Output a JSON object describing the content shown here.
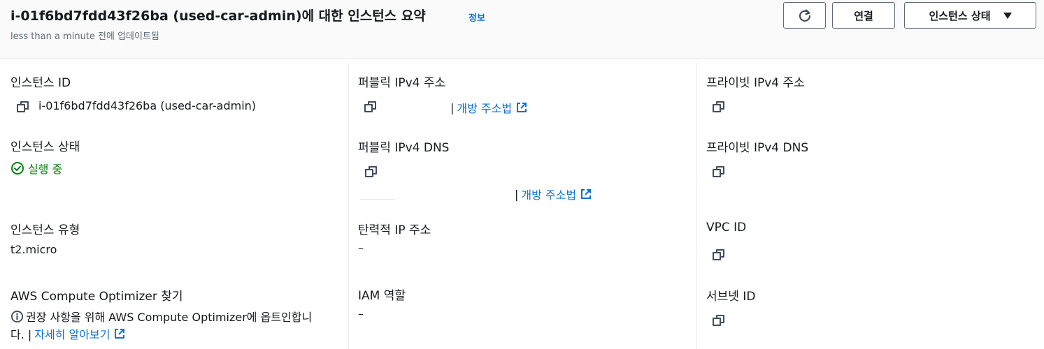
{
  "header": {
    "title": "i-01f6bd7fdd43f26ba (used-car-admin)에 대한 인스턴스 요약",
    "info_link": "정보",
    "updated": "less than a minute 전에 업데이트됨",
    "connect_label": "연결",
    "state_label": "인스턴스 상태"
  },
  "col1": {
    "instance_id_label": "인스턴스 ID",
    "instance_id_value": "i-01f6bd7fdd43f26ba (used-car-admin)",
    "state_label": "인스턴스 상태",
    "state_value": "실행 중",
    "type_label": "인스턴스 유형",
    "type_value": "t2.micro",
    "optimizer_label": "AWS Compute Optimizer 찾기",
    "optimizer_text_line1": "권장 사항을 위해 AWS Compute Optimizer에 옵트인합니",
    "optimizer_text_line2": "다. |",
    "optimizer_link": "자세히 알아보기"
  },
  "col2": {
    "public_ipv4_label": "퍼블릭 IPv4 주소",
    "public_ipv4_link": "개방 주소법",
    "public_dns_label": "퍼블릭 IPv4 DNS",
    "public_dns_link": "개방 주소법",
    "elastic_ip_label": "탄력적 IP 주소",
    "elastic_ip_value": "–",
    "iam_label": "IAM 역할",
    "iam_value": "–",
    "separator": "|"
  },
  "col3": {
    "private_ipv4_label": "프라이빗 IPv4 주소",
    "private_dns_label": "프라이빗 IPv4 DNS",
    "vpc_label": "VPC ID",
    "subnet_label": "서브넷 ID"
  },
  "icons": {
    "refresh": "refresh-icon",
    "caret": "caret-down-icon",
    "copy": "copy-icon",
    "external": "external-link-icon",
    "status_ok": "status-check-icon",
    "info": "info-circle-icon"
  },
  "colors": {
    "link": "#0972d3",
    "success": "#037f0c",
    "text": "#16191f",
    "muted": "#5f6b7a"
  }
}
